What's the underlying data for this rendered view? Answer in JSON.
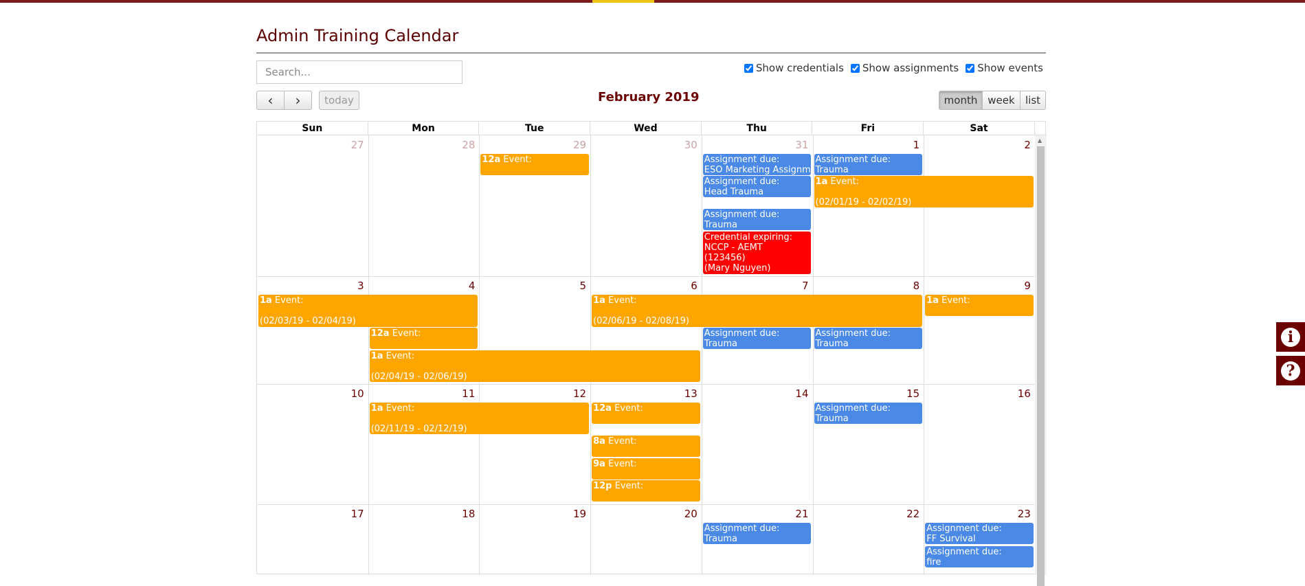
{
  "page": {
    "title": "Admin Training Calendar"
  },
  "search": {
    "placeholder": "Search..."
  },
  "filters": [
    {
      "label": "Show credentials",
      "checked": true
    },
    {
      "label": "Show assignments",
      "checked": true
    },
    {
      "label": "Show events",
      "checked": true
    }
  ],
  "toolbar": {
    "prev_icon": "‹",
    "next_icon": "›",
    "today_label": "today",
    "month_title": "February 2019",
    "views": [
      "month",
      "week",
      "list"
    ],
    "active_view": "month"
  },
  "weekdays": [
    "Sun",
    "Mon",
    "Tue",
    "Wed",
    "Thu",
    "Fri",
    "Sat"
  ],
  "weeks": [
    [
      {
        "d": "27",
        "other": true
      },
      {
        "d": "28",
        "other": true
      },
      {
        "d": "29",
        "other": true
      },
      {
        "d": "30",
        "other": true
      },
      {
        "d": "31",
        "other": true
      },
      {
        "d": "1"
      },
      {
        "d": "2"
      }
    ],
    [
      {
        "d": "3"
      },
      {
        "d": "4"
      },
      {
        "d": "5"
      },
      {
        "d": "6"
      },
      {
        "d": "7"
      },
      {
        "d": "8"
      },
      {
        "d": "9"
      }
    ],
    [
      {
        "d": "10"
      },
      {
        "d": "11"
      },
      {
        "d": "12"
      },
      {
        "d": "13"
      },
      {
        "d": "14"
      },
      {
        "d": "15"
      },
      {
        "d": "16"
      }
    ],
    [
      {
        "d": "17"
      },
      {
        "d": "18"
      },
      {
        "d": "19"
      },
      {
        "d": "20"
      },
      {
        "d": "21"
      },
      {
        "d": "22"
      },
      {
        "d": "23"
      }
    ]
  ],
  "colors": {
    "event": "#ffa500",
    "assignment": "#4a89e6",
    "credential": "#ff0000",
    "brand": "#6b0000"
  },
  "events": [
    {
      "type": "event",
      "week": 0,
      "day": 2,
      "span": 1,
      "time": "12a",
      "lines": [
        "Event:"
      ]
    },
    {
      "type": "assignment",
      "week": 0,
      "day": 4,
      "span": 1,
      "lines": [
        "Assignment due:",
        "ESO Marketing Assignment"
      ]
    },
    {
      "type": "assignment",
      "week": 0,
      "day": 4,
      "span": 1,
      "lines": [
        "Assignment due:",
        "Head Trauma"
      ]
    },
    {
      "type": "assignment",
      "week": 0,
      "day": 4,
      "span": 1,
      "lines": [
        "Assignment due:",
        "Trauma"
      ]
    },
    {
      "type": "credential",
      "week": 0,
      "day": 4,
      "span": 1,
      "lines": [
        "Credential expiring:",
        "NCCP - AEMT",
        "(123456)",
        "(Mary Nguyen)"
      ]
    },
    {
      "type": "assignment",
      "week": 0,
      "day": 5,
      "span": 1,
      "lines": [
        "Assignment due:",
        "Trauma"
      ]
    },
    {
      "type": "event",
      "week": 0,
      "day": 5,
      "span": 2,
      "time": "1a",
      "lines": [
        "Event:",
        "",
        "(02/01/19 - 02/02/19)"
      ]
    },
    {
      "type": "event",
      "week": 1,
      "day": 0,
      "span": 2,
      "time": "1a",
      "lines": [
        "Event:",
        "",
        "(02/03/19 - 02/04/19)"
      ]
    },
    {
      "type": "event",
      "week": 1,
      "day": 3,
      "span": 3,
      "time": "1a",
      "lines": [
        "Event:",
        "",
        "(02/06/19 - 02/08/19)"
      ]
    },
    {
      "type": "event",
      "week": 1,
      "day": 6,
      "span": 1,
      "time": "1a",
      "lines": [
        "Event:"
      ]
    },
    {
      "type": "event",
      "week": 1,
      "day": 1,
      "span": 1,
      "time": "12a",
      "lines": [
        "Event:"
      ]
    },
    {
      "type": "assignment",
      "week": 1,
      "day": 4,
      "span": 1,
      "lines": [
        "Assignment due:",
        "Trauma"
      ]
    },
    {
      "type": "assignment",
      "week": 1,
      "day": 5,
      "span": 1,
      "lines": [
        "Assignment due:",
        "Trauma"
      ]
    },
    {
      "type": "event",
      "week": 1,
      "day": 1,
      "span": 3,
      "time": "1a",
      "lines": [
        "Event:",
        "",
        "(02/04/19 - 02/06/19)"
      ]
    },
    {
      "type": "event",
      "week": 2,
      "day": 1,
      "span": 2,
      "time": "1a",
      "lines": [
        "Event:",
        "",
        "(02/11/19 - 02/12/19)"
      ]
    },
    {
      "type": "event",
      "week": 2,
      "day": 3,
      "span": 1,
      "time": "12a",
      "lines": [
        "Event:"
      ]
    },
    {
      "type": "event",
      "week": 2,
      "day": 3,
      "span": 1,
      "time": "8a",
      "lines": [
        "Event:"
      ]
    },
    {
      "type": "event",
      "week": 2,
      "day": 3,
      "span": 1,
      "time": "9a",
      "lines": [
        "Event:"
      ]
    },
    {
      "type": "event",
      "week": 2,
      "day": 3,
      "span": 1,
      "time": "12p",
      "lines": [
        "Event:"
      ]
    },
    {
      "type": "assignment",
      "week": 2,
      "day": 5,
      "span": 1,
      "lines": [
        "Assignment due:",
        "Trauma"
      ]
    },
    {
      "type": "assignment",
      "week": 3,
      "day": 4,
      "span": 1,
      "lines": [
        "Assignment due:",
        "Trauma"
      ]
    },
    {
      "type": "assignment",
      "week": 3,
      "day": 6,
      "span": 1,
      "lines": [
        "Assignment due:",
        "FF Survival"
      ]
    },
    {
      "type": "assignment",
      "week": 3,
      "day": 6,
      "span": 1,
      "lines": [
        "Assignment due:",
        "fire"
      ]
    }
  ],
  "side_buttons": [
    {
      "icon": "info-icon",
      "glyph": "i"
    },
    {
      "icon": "help-icon",
      "glyph": "?"
    }
  ]
}
